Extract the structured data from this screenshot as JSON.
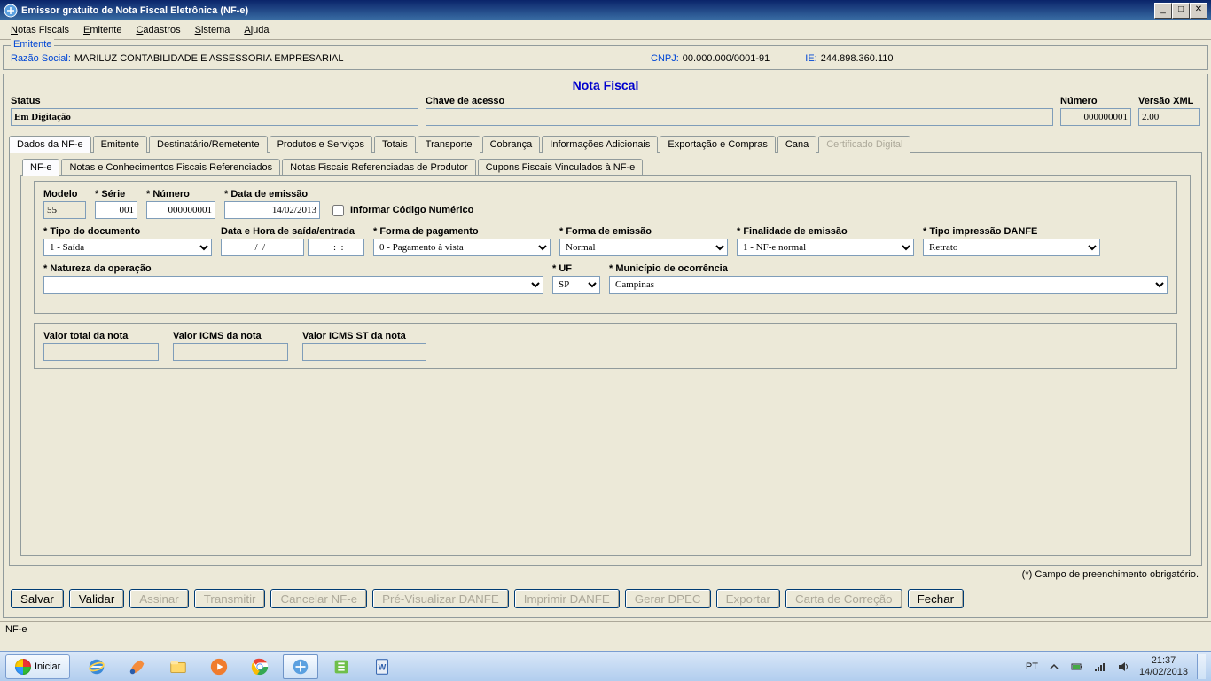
{
  "window": {
    "title": "Emissor gratuito de Nota Fiscal Eletrônica (NF-e)"
  },
  "menu": {
    "items": [
      {
        "label": "Notas Fiscais",
        "ul": "N",
        "rest": "otas Fiscais"
      },
      {
        "label": "Emitente",
        "ul": "E",
        "rest": "mitente"
      },
      {
        "label": "Cadastros",
        "ul": "C",
        "rest": "adastros"
      },
      {
        "label": "Sistema",
        "ul": "S",
        "rest": "istema"
      },
      {
        "label": "Ajuda",
        "ul": "A",
        "rest": "juda"
      }
    ]
  },
  "emitente": {
    "legend": "Emitente",
    "razao_label": "Razão Social:",
    "razao_value": "MARILUZ CONTABILIDADE E ASSESSORIA EMPRESARIAL",
    "cnpj_label": "CNPJ:",
    "cnpj_value": "00.000.000/0001-91",
    "ie_label": "IE:",
    "ie_value": "244.898.360.110"
  },
  "nf": {
    "title": "Nota Fiscal",
    "status_label": "Status",
    "status_value": "Em Digitação",
    "chave_label": "Chave de acesso",
    "chave_value": "",
    "numero_label": "Número",
    "numero_value": "000000001",
    "versao_label": "Versão XML",
    "versao_value": "2.00"
  },
  "tabs_main": [
    {
      "label": "Dados da NF-e",
      "name": "tab-dados-nfe",
      "active": true
    },
    {
      "label": "Emitente",
      "name": "tab-emitente"
    },
    {
      "label": "Destinatário/Remetente",
      "name": "tab-destinatario"
    },
    {
      "label": "Produtos e Serviços",
      "name": "tab-produtos"
    },
    {
      "label": "Totais",
      "name": "tab-totais"
    },
    {
      "label": "Transporte",
      "name": "tab-transporte"
    },
    {
      "label": "Cobrança",
      "name": "tab-cobranca"
    },
    {
      "label": "Informações Adicionais",
      "name": "tab-info-adicionais"
    },
    {
      "label": "Exportação e Compras",
      "name": "tab-exportacao"
    },
    {
      "label": "Cana",
      "name": "tab-cana"
    },
    {
      "label": "Certificado Digital",
      "name": "tab-certificado",
      "disabled": true
    }
  ],
  "tabs_sub": [
    {
      "label": "NF-e",
      "name": "subtab-nfe",
      "active": true
    },
    {
      "label": "Notas e Conhecimentos Fiscais Referenciados",
      "name": "subtab-notas-ref"
    },
    {
      "label": "Notas Fiscais Referenciadas de Produtor",
      "name": "subtab-notas-produtor"
    },
    {
      "label": "Cupons Fiscais Vinculados à NF-e",
      "name": "subtab-cupons"
    }
  ],
  "form": {
    "modelo_label": "Modelo",
    "modelo_value": "55",
    "serie_label": "* Série",
    "serie_value": "001",
    "numero_label": "* Número",
    "numero_value": "000000001",
    "data_emissao_label": "* Data de emissão",
    "data_emissao_value": "14/02/2013",
    "check_codigo_label": "Informar Código Numérico",
    "tipo_doc_label": "* Tipo do documento",
    "tipo_doc_value": "1 - Saída",
    "data_saida_label": "Data e Hora de saída/entrada",
    "data_saida_value": "  /  /    ",
    "hora_saida_value": "  :  :",
    "forma_pag_label": "* Forma de pagamento",
    "forma_pag_value": "0 - Pagamento à vista",
    "forma_emissao_label": "* Forma de emissão",
    "forma_emissao_value": "Normal",
    "finalidade_label": "* Finalidade de emissão",
    "finalidade_value": "1 - NF-e normal",
    "tipo_danfe_label": "* Tipo impressão DANFE",
    "tipo_danfe_value": "Retrato",
    "natureza_label": "* Natureza da operação",
    "natureza_value": "",
    "uf_label": "* UF",
    "uf_value": "SP",
    "municipio_label": "* Município de ocorrência",
    "municipio_value": "Campinas"
  },
  "totals": {
    "total_nota_label": "Valor total da nota",
    "total_nota_value": "",
    "icms_label": "Valor ICMS da nota",
    "icms_value": "",
    "icms_st_label": "Valor ICMS ST da nota",
    "icms_st_value": ""
  },
  "footnote": "(*) Campo de preenchimento obrigatório.",
  "buttons": [
    {
      "label": "Salvar",
      "name": "salvar-button",
      "enabled": true
    },
    {
      "label": "Validar",
      "name": "validar-button",
      "enabled": true
    },
    {
      "label": "Assinar",
      "name": "assinar-button",
      "enabled": false
    },
    {
      "label": "Transmitir",
      "name": "transmitir-button",
      "enabled": false
    },
    {
      "label": "Cancelar NF-e",
      "name": "cancelar-nfe-button",
      "enabled": false
    },
    {
      "label": "Pré-Visualizar DANFE",
      "name": "previsualizar-button",
      "enabled": false
    },
    {
      "label": "Imprimir DANFE",
      "name": "imprimir-button",
      "enabled": false
    },
    {
      "label": "Gerar DPEC",
      "name": "gerar-dpec-button",
      "enabled": false
    },
    {
      "label": "Exportar",
      "name": "exportar-button",
      "enabled": false
    },
    {
      "label": "Carta de Correção",
      "name": "carta-correcao-button",
      "enabled": false
    },
    {
      "label": "Fechar",
      "name": "fechar-button",
      "enabled": true
    }
  ],
  "statusbar": "NF-e",
  "taskbar": {
    "start": "Iniciar",
    "lang": "PT",
    "time": "21:37",
    "date": "14/02/2013"
  }
}
